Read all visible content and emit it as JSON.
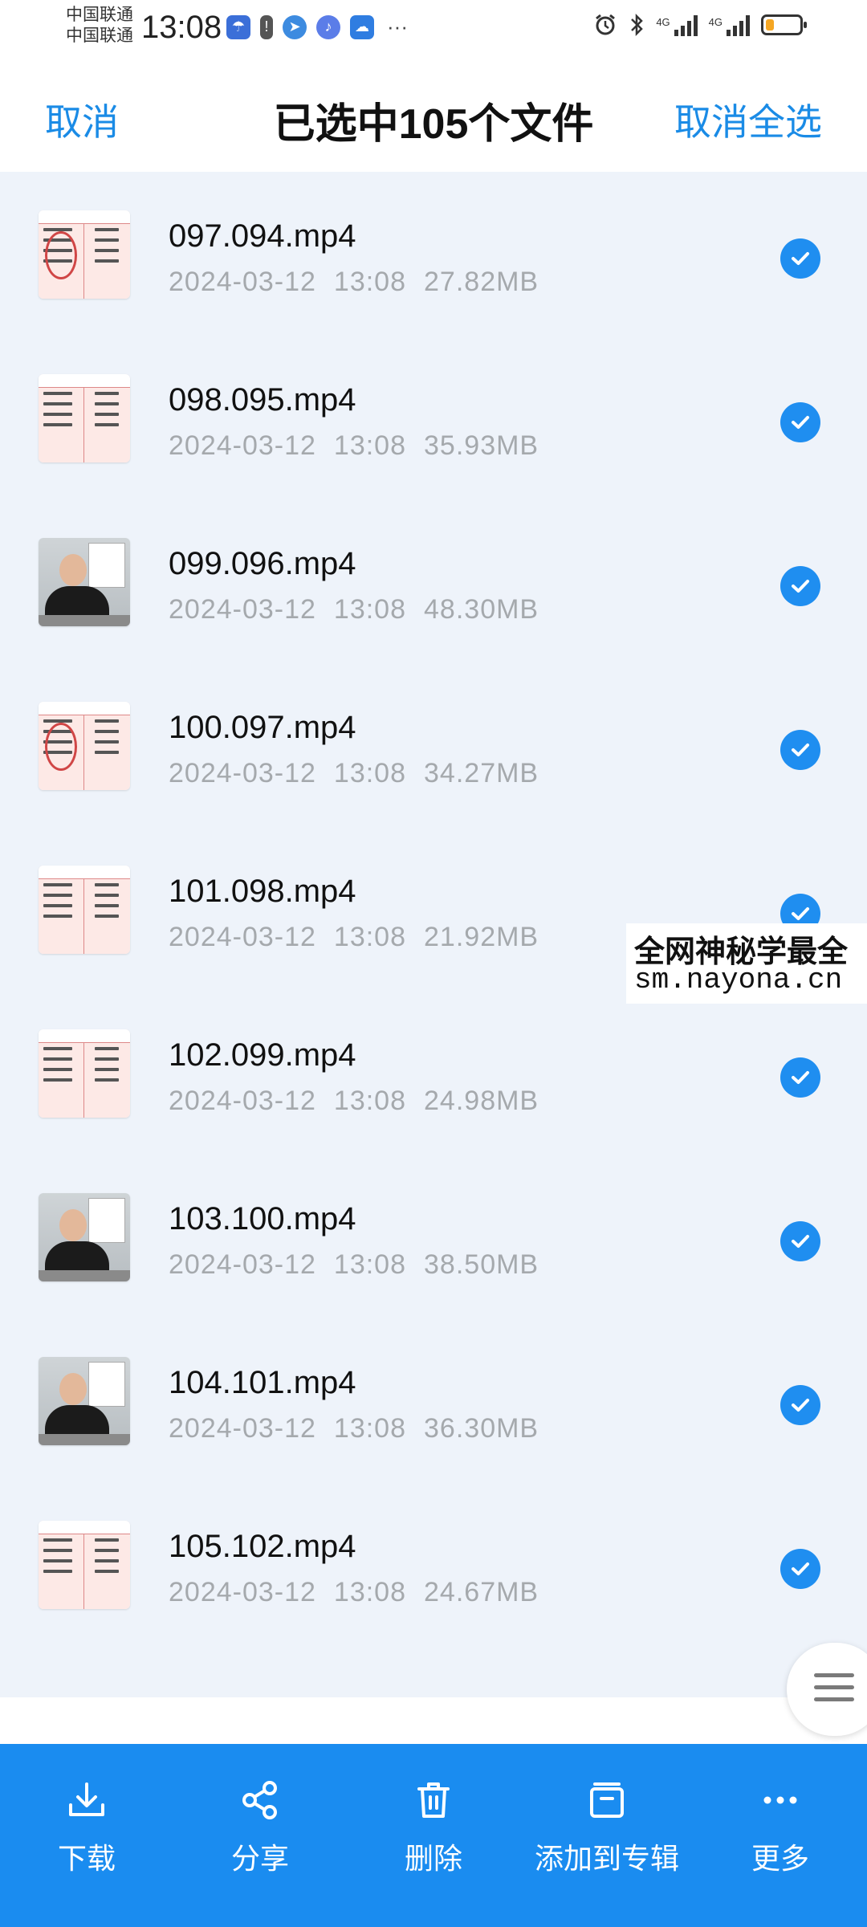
{
  "status_bar": {
    "carrier_1": "中国联通",
    "carrier_2": "中国联通",
    "time": "13:08",
    "network_1": "4G",
    "network_2": "4G",
    "battery_level": 0.25,
    "app_icons": [
      "weather-app",
      "alert",
      "maps",
      "music",
      "weather"
    ]
  },
  "header": {
    "cancel_label": "取消",
    "title": "已选中105个文件",
    "deselect_all_label": "取消全选"
  },
  "files": [
    {
      "name": "097.094.mp4",
      "date": "2024-03-12",
      "time": "13:08",
      "size": "27.82MB",
      "thumb": "chart",
      "selected": true
    },
    {
      "name": "098.095.mp4",
      "date": "2024-03-12",
      "time": "13:08",
      "size": "35.93MB",
      "thumb": "chart",
      "selected": true
    },
    {
      "name": "099.096.mp4",
      "date": "2024-03-12",
      "time": "13:08",
      "size": "48.30MB",
      "thumb": "video",
      "selected": true
    },
    {
      "name": "100.097.mp4",
      "date": "2024-03-12",
      "time": "13:08",
      "size": "34.27MB",
      "thumb": "chart",
      "selected": true
    },
    {
      "name": "101.098.mp4",
      "date": "2024-03-12",
      "time": "13:08",
      "size": "21.92MB",
      "thumb": "chart",
      "selected": true
    },
    {
      "name": "102.099.mp4",
      "date": "2024-03-12",
      "time": "13:08",
      "size": "24.98MB",
      "thumb": "chart",
      "selected": true
    },
    {
      "name": "103.100.mp4",
      "date": "2024-03-12",
      "time": "13:08",
      "size": "38.50MB",
      "thumb": "video",
      "selected": true
    },
    {
      "name": "104.101.mp4",
      "date": "2024-03-12",
      "time": "13:08",
      "size": "36.30MB",
      "thumb": "video",
      "selected": true
    },
    {
      "name": "105.102.mp4",
      "date": "2024-03-12",
      "time": "13:08",
      "size": "24.67MB",
      "thumb": "chart",
      "selected": true
    }
  ],
  "watermark": {
    "line1": "全网神秘学最全",
    "line2": "sm.nayona.cn"
  },
  "toolbar": {
    "download": "下载",
    "share": "分享",
    "delete": "删除",
    "add_to_album": "添加到专辑",
    "more": "更多"
  },
  "colors": {
    "accent": "#1a8cf0",
    "check": "#1f8ef0",
    "background": "#eef3fa",
    "meta_text": "#a5a9ad"
  }
}
